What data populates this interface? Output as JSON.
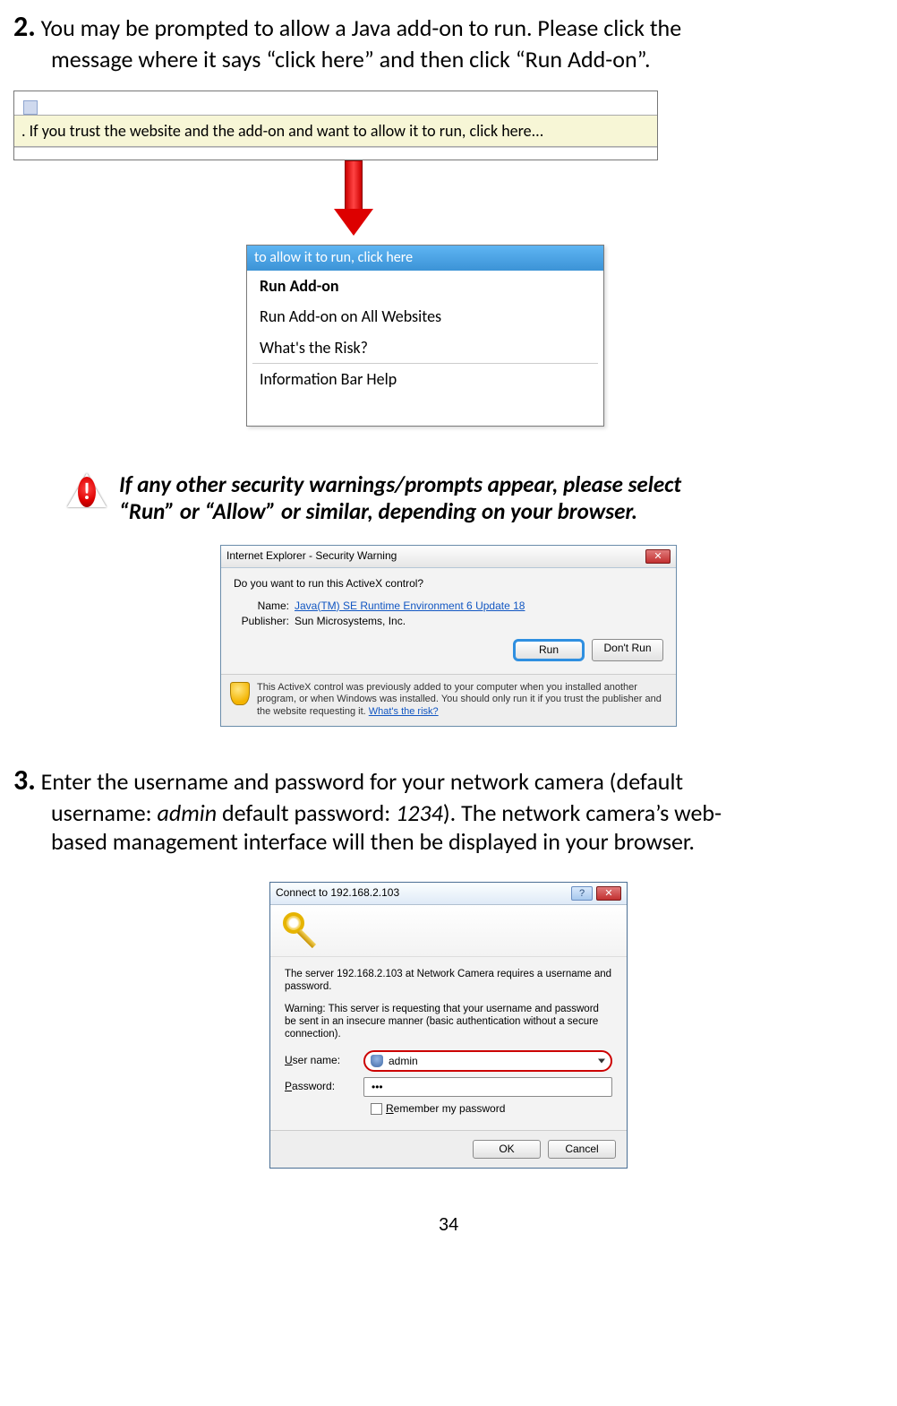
{
  "step2": {
    "num": "2.",
    "text_a": "You may be prompted to allow a Java add-on to run. Please click the ",
    "text_b": "message where it says “click here” and then click “Run Add-on”."
  },
  "infobar": {
    "msg": ". If you trust the website and the add-on and want to allow it to run, click here..."
  },
  "context_menu": {
    "title": "to allow it to run, click here",
    "items": [
      "Run Add-on",
      "Run Add-on on All Websites",
      "What's the Risk?",
      "Information Bar Help"
    ]
  },
  "warn": {
    "line1": "If any other security warnings/prompts appear, please select ",
    "line2": "“Run” or “Allow” or similar, depending on your browser."
  },
  "secwarn": {
    "title": "Internet Explorer - Security Warning",
    "question": "Do you want to run this ActiveX control?",
    "name_label": "Name:",
    "name_value": "Java(TM) SE Runtime Environment 6 Update 18",
    "pub_label": "Publisher:",
    "pub_value": "Sun Microsystems, Inc.",
    "run": "Run",
    "dont_run": "Don't Run",
    "footer_text": "This ActiveX control was previously added to your computer when you installed another program, or when Windows was installed. You should only run it if you trust the publisher and the website requesting it.  ",
    "footer_link": "What's the risk?"
  },
  "step3": {
    "num": "3.",
    "text_a": " Enter the username and password for your network camera (default ",
    "text_b1": "username: ",
    "text_b2_italic": "admin",
    "text_b3": " default password: ",
    "text_b4_italic": "1234",
    "text_b5": "). The network camera’s web-",
    "text_c": "based management interface will then be displayed in your browser."
  },
  "login": {
    "title": "Connect to 192.168.2.103",
    "msg1": "The server 192.168.2.103 at Network Camera requires a username and password.",
    "msg2": "Warning: This server is requesting that your username and password be sent in an insecure manner (basic authentication without a secure connection).",
    "user_label": "User name:",
    "user_value": "admin",
    "pass_label": "Password:",
    "pass_value": "•••",
    "remember": "Remember my password",
    "ok": "OK",
    "cancel": "Cancel",
    "help": "? "
  },
  "page_number": "34"
}
